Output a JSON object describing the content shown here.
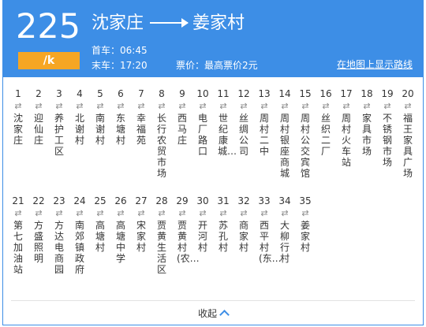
{
  "route": {
    "number": "225",
    "badge": "/k",
    "from": "沈家庄",
    "to": "姜家村",
    "first_bus_label": "首车：",
    "first_bus": "06:45",
    "last_bus_label": "末车：",
    "last_bus": "17:20",
    "fare": "票价：最高票价2元",
    "map_link": "在地图上显示路线"
  },
  "stops": [
    {
      "num": "1",
      "name": "沈家庄"
    },
    {
      "num": "2",
      "name": "迎仙庄"
    },
    {
      "num": "3",
      "name": "养护工区"
    },
    {
      "num": "4",
      "name": "北谢村"
    },
    {
      "num": "5",
      "name": "南谢村"
    },
    {
      "num": "6",
      "name": "东塘村"
    },
    {
      "num": "7",
      "name": "幸福苑"
    },
    {
      "num": "8",
      "name": "长行农贸市场"
    },
    {
      "num": "9",
      "name": "西马庄"
    },
    {
      "num": "10",
      "name": "电厂路口"
    },
    {
      "num": "11",
      "name": "世纪康城…"
    },
    {
      "num": "12",
      "name": "丝绸公司"
    },
    {
      "num": "13",
      "name": "周村二中"
    },
    {
      "num": "14",
      "name": "周村银座商城"
    },
    {
      "num": "15",
      "name": "周村公交宾馆"
    },
    {
      "num": "16",
      "name": "丝织二厂"
    },
    {
      "num": "17",
      "name": "周村火车站"
    },
    {
      "num": "18",
      "name": "家具市场"
    },
    {
      "num": "19",
      "name": "不锈钢市场"
    },
    {
      "num": "20",
      "name": "福王家具广场"
    },
    {
      "num": "21",
      "name": "第七加油站"
    },
    {
      "num": "22",
      "name": "方盛照明"
    },
    {
      "num": "23",
      "name": "方达电商园"
    },
    {
      "num": "24",
      "name": "南郊镇政府"
    },
    {
      "num": "25",
      "name": "高塘村"
    },
    {
      "num": "26",
      "name": "高塘中学"
    },
    {
      "num": "27",
      "name": "宋家村"
    },
    {
      "num": "28",
      "name": "贾黄生活区"
    },
    {
      "num": "29",
      "name": "贾黄村(农…"
    },
    {
      "num": "30",
      "name": "开河村"
    },
    {
      "num": "31",
      "name": "苏孔村"
    },
    {
      "num": "32",
      "name": "商家村"
    },
    {
      "num": "33",
      "name": "西平村(东…"
    },
    {
      "num": "34",
      "name": "大柳行村"
    },
    {
      "num": "35",
      "name": "姜家村"
    }
  ],
  "stop_arrow": "⇄",
  "collapse_label": "收起",
  "colors": {
    "header": "#3d8ee6",
    "badge": "#f6a623"
  }
}
